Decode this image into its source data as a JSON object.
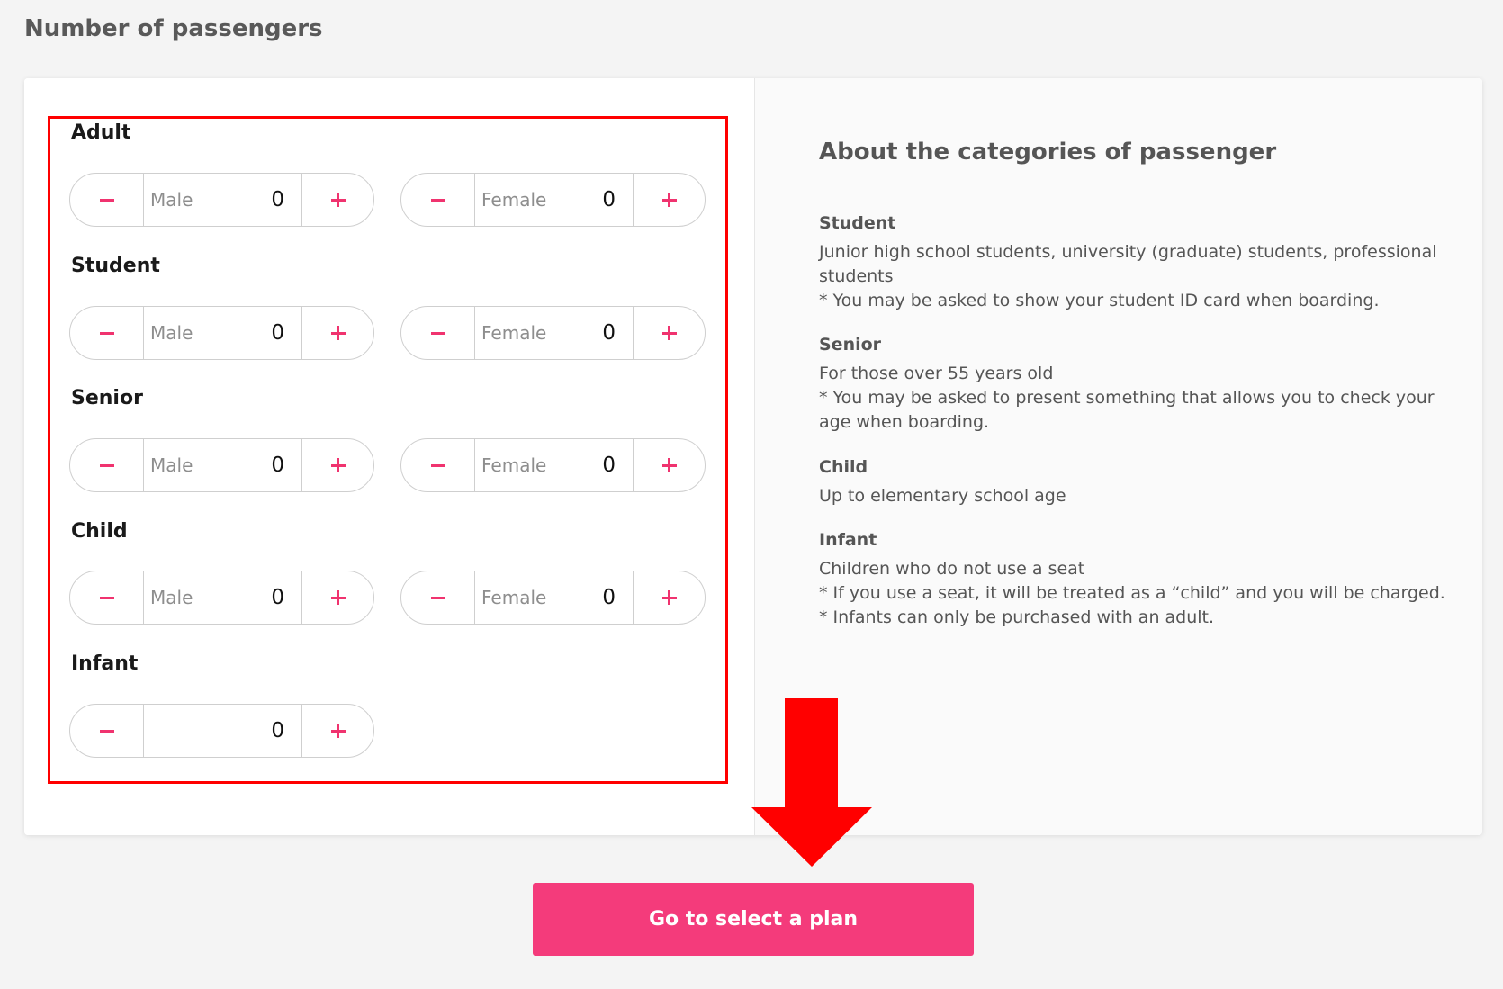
{
  "page": {
    "title": "Number of passengers"
  },
  "passengers": {
    "categories": [
      {
        "label": "Adult",
        "steppers": [
          {
            "gender": "Male",
            "count": "0"
          },
          {
            "gender": "Female",
            "count": "0"
          }
        ]
      },
      {
        "label": "Student",
        "steppers": [
          {
            "gender": "Male",
            "count": "0"
          },
          {
            "gender": "Female",
            "count": "0"
          }
        ]
      },
      {
        "label": "Senior",
        "steppers": [
          {
            "gender": "Male",
            "count": "0"
          },
          {
            "gender": "Female",
            "count": "0"
          }
        ]
      },
      {
        "label": "Child",
        "steppers": [
          {
            "gender": "Male",
            "count": "0"
          },
          {
            "gender": "Female",
            "count": "0"
          }
        ]
      },
      {
        "label": "Infant",
        "steppers": [
          {
            "gender": "",
            "count": "0"
          }
        ]
      }
    ],
    "icons": {
      "decrement": "minus-icon",
      "increment": "plus-icon"
    }
  },
  "about": {
    "title": "About the categories of passenger",
    "sections": [
      {
        "heading": "Student",
        "lines": [
          "Junior high school students, university (graduate) students, professional students",
          "* You may be asked to show your student ID card when boarding."
        ]
      },
      {
        "heading": "Senior",
        "lines": [
          "For those over 55 years old",
          "* You may be asked to present something that allows you to check your age when boarding."
        ]
      },
      {
        "heading": "Child",
        "lines": [
          "Up to elementary school age"
        ]
      },
      {
        "heading": "Infant",
        "lines": [
          "Children who do not use a seat",
          "* If you use a seat, it will be treated as a “child” and you will be charged.",
          "* Infants can only be purchased with an adult."
        ]
      }
    ]
  },
  "annotation": {
    "arrow": "down-arrow-icon",
    "highlight_color": "#ff0000"
  },
  "actions": {
    "next_label": "Go to select a plan"
  },
  "colors": {
    "accent": "#f43b7b",
    "stepper_icon": "#f0336f",
    "page_background": "#f4f4f4"
  }
}
